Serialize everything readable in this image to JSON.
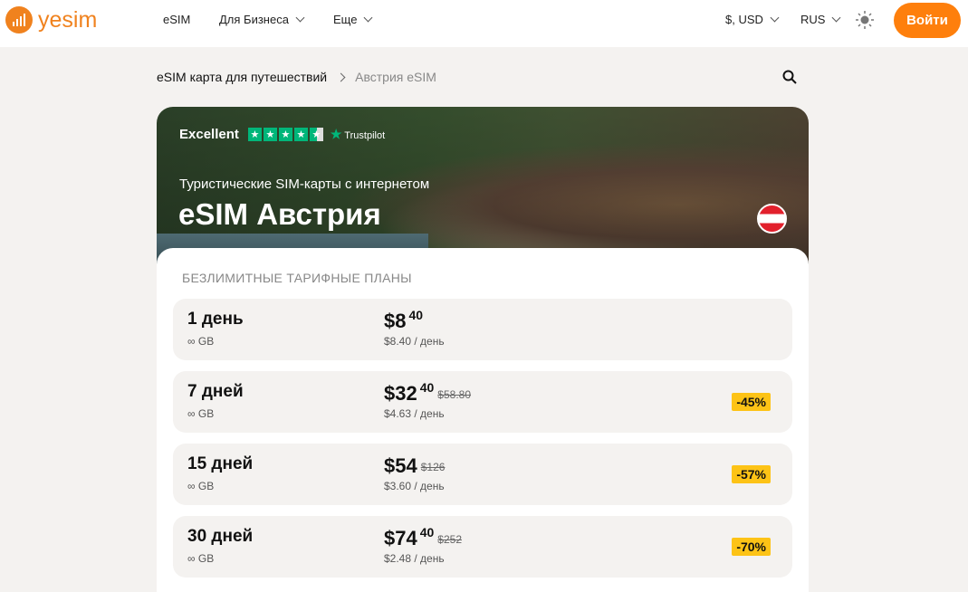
{
  "header": {
    "logo": "yesim",
    "nav": [
      "eSIM",
      "Для Бизнеса",
      "Еще"
    ],
    "currency": "$, USD",
    "language": "RUS",
    "login": "Войти"
  },
  "breadcrumb": {
    "parent": "eSIM карта для путешествий",
    "current": "Австрия eSIM"
  },
  "hero": {
    "rating_label": "Excellent",
    "trustpilot": "Trustpilot",
    "subtitle": "Туристические SIM-карты с интернетом",
    "title": "eSIM Австрия"
  },
  "section_title": "БЕЗЛИМИТНЫЕ ТАРИФНЫЕ ПЛАНЫ",
  "plans": [
    {
      "duration": "1 день",
      "data": "∞ GB",
      "price": "$8",
      "cents": "40",
      "old": "",
      "per_day": "$8.40 / день",
      "discount": ""
    },
    {
      "duration": "7 дней",
      "data": "∞ GB",
      "price": "$32",
      "cents": "40",
      "old": "$58.80",
      "per_day": "$4.63 / день",
      "discount": "-45%"
    },
    {
      "duration": "15 дней",
      "data": "∞ GB",
      "price": "$54",
      "cents": "",
      "old": "$126",
      "per_day": "$3.60 / день",
      "discount": "-57%"
    },
    {
      "duration": "30 дней",
      "data": "∞ GB",
      "price": "$74",
      "cents": "40",
      "old": "$252",
      "per_day": "$2.48 / день",
      "discount": "-70%"
    }
  ]
}
